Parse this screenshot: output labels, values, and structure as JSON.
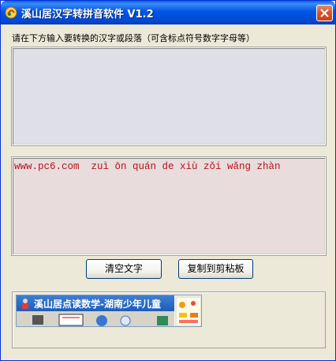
{
  "window": {
    "title": "溪山居汉字转拼音软件 V1.2"
  },
  "input": {
    "instruction": "请在下方输入要转换的汉字或段落（可含标点符号数字字母等）",
    "value": ""
  },
  "output": {
    "value": "www.pc6.com  zuì ōn quán de xiù zǒi wǎng zhàn"
  },
  "buttons": {
    "clear_label": "清空文字",
    "copy_label": "复制到剪粘板"
  },
  "ad": {
    "title": "溪山居点读数学-湖南少年儿童"
  },
  "colors": {
    "title_bar": "#0055e5",
    "output_text": "#b4141e",
    "input_bg": "#dfdfe7",
    "output_bg": "#e8dcdc"
  }
}
